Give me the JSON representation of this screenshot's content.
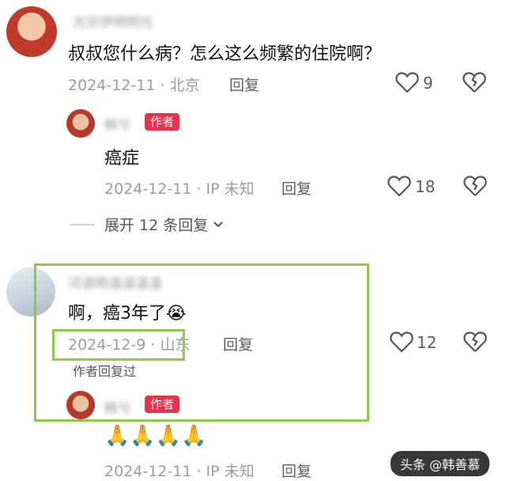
{
  "comment1": {
    "username": "光宗伊明明光",
    "text": "叔叔您什么病？怎么这么频繁的住院啊？",
    "meta": "2024-12-11 · 北京",
    "reply": "回复",
    "likes": "9"
  },
  "reply1": {
    "username": "韩兮",
    "badge": "作者",
    "text": "癌症",
    "meta": "2024-12-11 · IP 未知",
    "reply": "回复",
    "likes": "18"
  },
  "expand": {
    "label": "展开 12 条回复"
  },
  "comment2": {
    "username": "河源明温温温温",
    "text": "啊，癌3年了",
    "emoji": "😭",
    "meta": "2024-12-9 · 山东",
    "reply": "回复",
    "likes": "12",
    "author_replied": "作者回复过"
  },
  "reply2": {
    "username": "韩兮",
    "badge": "作者",
    "text": "🙏🙏🙏🙏",
    "meta": "2024-12-11 · IP 未知",
    "reply": "回复"
  },
  "watermark": {
    "text": "头条 @韩善慕"
  },
  "colors": {
    "author_badge": "#e8324c",
    "highlight": "#8cc94c"
  }
}
